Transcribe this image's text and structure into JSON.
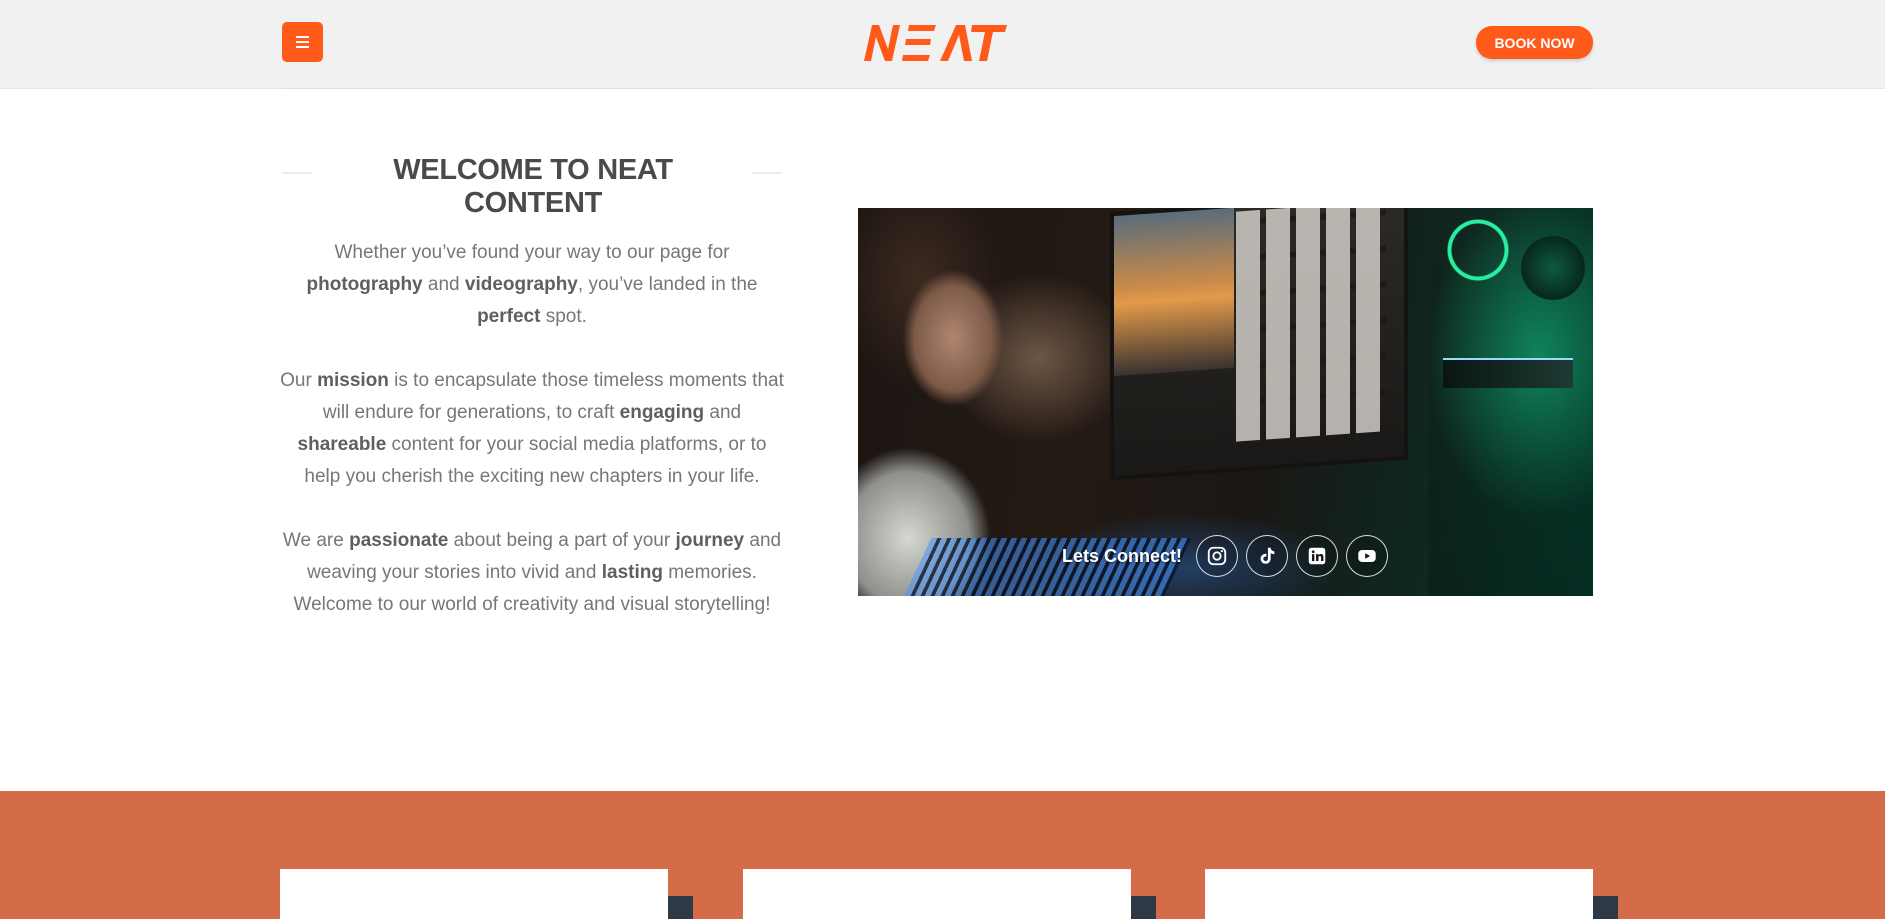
{
  "header": {
    "menu_icon": "hamburger-icon",
    "logo_text": "NEAT",
    "book_label": "BOOK NOW"
  },
  "welcome": {
    "title": "WELCOME TO NEAT CONTENT",
    "paragraphs": [
      [
        {
          "t": "Whether you’ve found your way to our page for "
        },
        {
          "t": "photography",
          "b": true
        },
        {
          "t": " and "
        },
        {
          "t": "videography",
          "b": true
        },
        {
          "t": ", you’ve landed in the "
        },
        {
          "t": "perfect",
          "b": true
        },
        {
          "t": " spot."
        }
      ],
      [
        {
          "t": "Our "
        },
        {
          "t": "mission",
          "b": true
        },
        {
          "t": " is to encapsulate those timeless moments that will endure for generations, to craft "
        },
        {
          "t": "engaging",
          "b": true
        },
        {
          "t": " and "
        },
        {
          "t": "shareable",
          "b": true
        },
        {
          "t": " content for your social media platforms, or to help you cherish the exciting new chapters in your life."
        }
      ],
      [
        {
          "t": "We are "
        },
        {
          "t": "passionate",
          "b": true
        },
        {
          "t": " about being a part of your "
        },
        {
          "t": "journey",
          "b": true
        },
        {
          "t": " and weaving your stories into vivid and "
        },
        {
          "t": "lasting",
          "b": true
        },
        {
          "t": " memories. Welcome to our world of creativity and visual storytelling!"
        }
      ]
    ]
  },
  "connect": {
    "label": "Lets Connect!",
    "socials": [
      {
        "name": "instagram-icon"
      },
      {
        "name": "tiktok-icon"
      },
      {
        "name": "linkedin-icon"
      },
      {
        "name": "youtube-icon"
      }
    ]
  },
  "colors": {
    "accent": "#ff5a1a",
    "section_bg": "#d46b49",
    "card_shadow": "#2d3a45"
  }
}
